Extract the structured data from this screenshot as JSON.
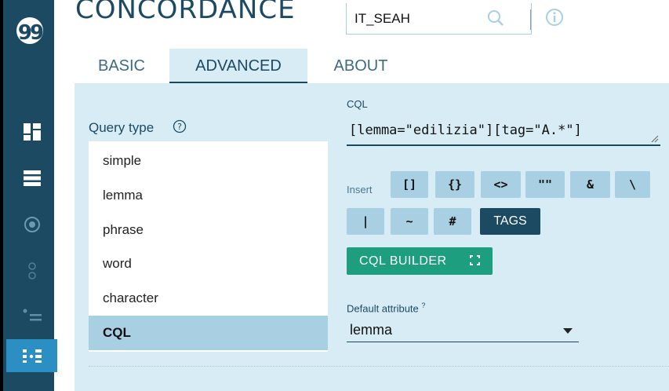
{
  "app": {
    "title": "CONCORDANCE",
    "logo_glyph": "99",
    "accent_color": "#1c4a63",
    "rail_active_color": "#2b8fc4",
    "builder_color": "#1d9e7e"
  },
  "sidebar": {
    "icons": [
      "dashboard-icon",
      "list-icon",
      "target-icon",
      "dots-vertical-icon",
      "bullet-list-icon",
      "dots-grid-icon"
    ],
    "active_index": 5
  },
  "corpus": {
    "value": "IT_SEAH"
  },
  "tabs": [
    {
      "label": "BASIC"
    },
    {
      "label": "ADVANCED",
      "active": true
    },
    {
      "label": "ABOUT"
    }
  ],
  "query_type": {
    "label": "Query type",
    "options": [
      "simple",
      "lemma",
      "phrase",
      "word",
      "character",
      "CQL"
    ],
    "selected": "CQL"
  },
  "cql": {
    "label": "CQL",
    "value": "[lemma=\"edilizia\"][tag=\"A.*\"]"
  },
  "insert": {
    "label": "Insert",
    "row1": [
      "[]",
      "{}",
      "<>",
      "\"\"",
      "&",
      "\\"
    ],
    "row2": [
      "|",
      "~",
      "#"
    ],
    "tags_label": "TAGS"
  },
  "builder": {
    "label": "CQL BUILDER"
  },
  "default_attribute": {
    "label": "Default attribute",
    "help_mark": "?",
    "value": "lemma"
  }
}
